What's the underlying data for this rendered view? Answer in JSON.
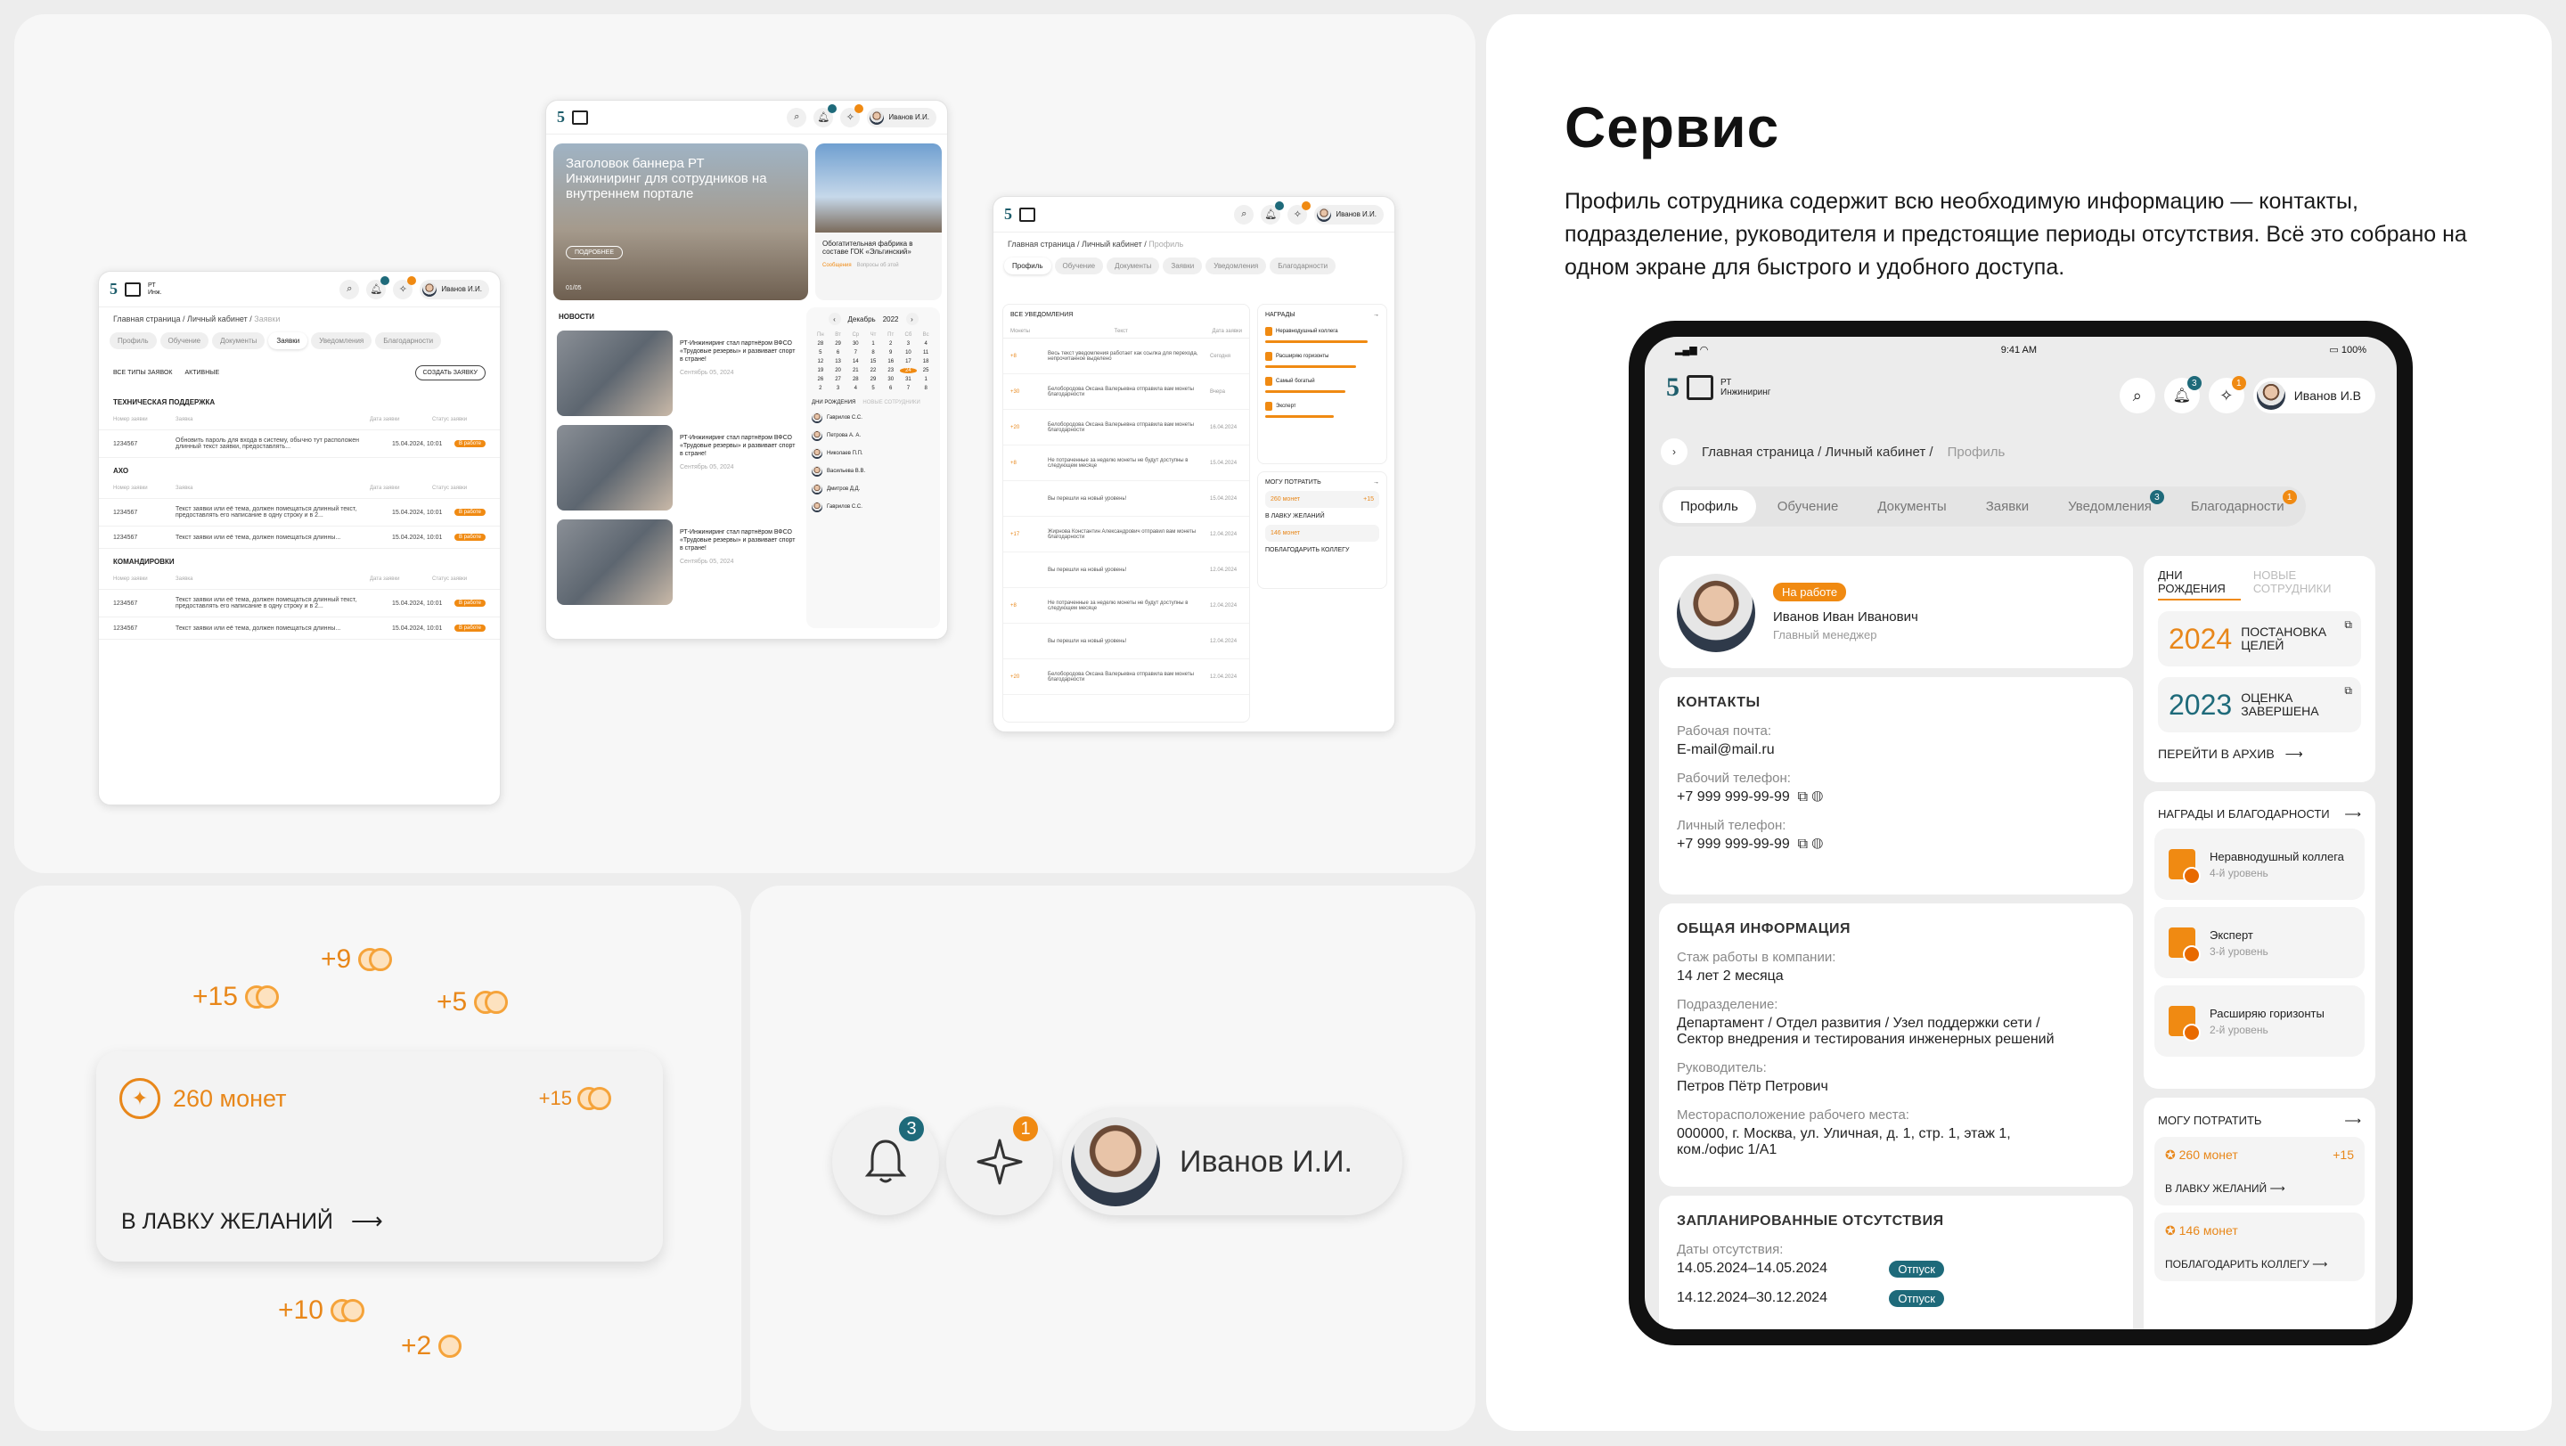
{
  "mock_requests": {
    "user": "Иванов И.И.",
    "crumb_path": "Главная страница / Личный кабинет /",
    "crumb_current": "Заявки",
    "tabs": [
      "Профиль",
      "Обучение",
      "Документы",
      "Заявки",
      "Уведомления",
      "Благодарности"
    ],
    "filter1": "ВСЕ ТИПЫ ЗАЯВОК",
    "filter2": "АКТИВНЫЕ",
    "create_label": "СОЗДАТЬ ЗАЯВКУ",
    "sections": [
      {
        "title": "ТЕХНИЧЕСКАЯ ПОДДЕРЖКА",
        "cols": [
          "Номер заявки",
          "Заявка",
          "Дата заявки",
          "Статус заявки"
        ],
        "rows": [
          {
            "num": "1234567",
            "text": "Обновить пароль для входа в систему, обычно тут расположен длинный текст заявки, предоставлять...",
            "date": "15.04.2024, 10:01",
            "status": "В работе"
          }
        ]
      },
      {
        "title": "АХО",
        "cols": [
          "Номер заявки",
          "Заявка",
          "Дата заявки",
          "Статус заявки"
        ],
        "rows": [
          {
            "num": "1234567",
            "text": "Текст заявки или её тема, должен помещаться длинный текст, предоставлять его написание в одну строку и в 2...",
            "date": "15.04.2024, 10:01",
            "status": "В работе"
          },
          {
            "num": "1234567",
            "text": "Текст заявки или её тема, должен помещаться длинны...",
            "date": "15.04.2024, 10:01",
            "status": "В работе"
          }
        ]
      },
      {
        "title": "КОМАНДИРОВКИ",
        "cols": [
          "Номер заявки",
          "Заявка",
          "Дата заявки",
          "Статус заявки"
        ],
        "rows": [
          {
            "num": "1234567",
            "text": "Текст заявки или её тема, должен помещаться длинный текст, предоставлять его написание в одну строку и в 2...",
            "date": "15.04.2024, 10:01",
            "status": "В работе"
          },
          {
            "num": "1234567",
            "text": "Текст заявки или её тема, должен помещаться длинны...",
            "date": "15.04.2024, 10:01",
            "status": "В работе"
          }
        ]
      }
    ]
  },
  "mock_portal": {
    "user": "Иванов И.И.",
    "banner_title": "Заголовок баннера РТ Инжиниринг для сотрудников на внутреннем портале",
    "banner_btn": "ПОДРОБНЕЕ",
    "banner_counter": "01/05",
    "side_caption": "Обогатительная фабрика в составе ГОК «Эльгинский»",
    "side_tabs": [
      "Сообщения",
      "Вопросы об этой"
    ],
    "news_title": "НОВОСТИ",
    "news": [
      {
        "text": "РТ-Инжиниринг стал партнёром ВФСО «Трудовые резервы» и развивает спорт в стране!",
        "date": "Сентябрь 05, 2024"
      },
      {
        "text": "РТ-Инжиниринг стал партнёром ВФСО «Трудовые резервы» и развивает спорт в стране!",
        "date": "Сентябрь 05, 2024"
      },
      {
        "text": "РТ-Инжиниринг стал партнёром ВФСО «Трудовые резервы» и развивает спорт в стране!",
        "date": "Сентябрь 05, 2024"
      }
    ],
    "cal_month": "Декабрь",
    "cal_year": "2022",
    "cal_days": [
      "Пн",
      "Вт",
      "Ср",
      "Чт",
      "Пт",
      "Сб",
      "Вс"
    ],
    "cal_nums": [
      "28",
      "29",
      "30",
      "1",
      "2",
      "3",
      "4",
      "5",
      "6",
      "7",
      "8",
      "9",
      "10",
      "11",
      "12",
      "13",
      "14",
      "15",
      "16",
      "17",
      "18",
      "19",
      "20",
      "21",
      "22",
      "23",
      "24",
      "25",
      "26",
      "27",
      "28",
      "29",
      "30",
      "31",
      "1",
      "2",
      "3",
      "4",
      "5",
      "6",
      "7",
      "8"
    ],
    "cal_selected": "24",
    "bday_tabs": [
      "ДНИ РОЖДЕНИЯ",
      "НОВЫЕ СОТРУДНИКИ"
    ],
    "bday": [
      "Гаврилов С.С.",
      "Петрова А. А.",
      "Николаев П.П.",
      "Васильева В.В.",
      "Дмитров Д.Д.",
      "Гаврилов С.С."
    ]
  },
  "mock_notifications": {
    "user": "Иванов И.И.",
    "crumb_path": "Главная страница / Личный кабинет /",
    "crumb_current": "Профиль",
    "tabs": [
      "Профиль",
      "Обучение",
      "Документы",
      "Заявки",
      "Уведомления",
      "Благодарности"
    ],
    "filter": "ВСЕ УВЕДОМЛЕНИЯ",
    "cols": [
      "Монеты",
      "Текст",
      "Дата заявки"
    ],
    "rows": [
      {
        "coins": "+8",
        "text": "Весь текст уведомления работает как ссылка для перехода, непрочитанное выделено",
        "date": "Сегодня"
      },
      {
        "coins": "+30",
        "text": "Белобородова Оксана Валерьевна отправила вам монеты благодарности",
        "date": "Вчера"
      },
      {
        "coins": "+20",
        "text": "Белобородова Оксана Валерьевна отправила вам монеты благодарности",
        "date": "16.04.2024"
      },
      {
        "coins": "+8",
        "text": "Не потраченные за неделю монеты не будут доступны в следующем месяце",
        "date": "15.04.2024"
      },
      {
        "coins": "",
        "text": "Вы перешли на новый уровень!",
        "date": "15.04.2024"
      },
      {
        "coins": "+17",
        "text": "Жирнова Константин Александрович отправил вам монеты благодарности",
        "date": "12.04.2024"
      },
      {
        "coins": "",
        "text": "Вы перешли на новый уровень!",
        "date": "12.04.2024"
      },
      {
        "coins": "+8",
        "text": "Не потраченные за неделю монеты не будут доступны в следующем месяце",
        "date": "12.04.2024"
      },
      {
        "coins": "",
        "text": "Вы перешли на новый уровень!",
        "date": "12.04.2024"
      },
      {
        "coins": "+20",
        "text": "Белобородова Оксана Валерьевна отправила вам монеты благодарности",
        "date": "12.04.2024"
      }
    ],
    "side_awards_title": "НАГРАДЫ",
    "side_awards": [
      "Неравнодушный коллега",
      "Расширяю горизонты",
      "Самый богатый",
      "Эксперт"
    ],
    "side_spend_title": "МОГУ ПОТРАТИТЬ",
    "side_coins": "260 монет",
    "side_plus": "+15",
    "side_shop": "В ЛАВКУ ЖЕЛАНИЙ",
    "side_coins2": "146 монет",
    "side_thank": "ПОБЛАГОДАРИТЬ КОЛЛЕГУ"
  },
  "coins_panel": {
    "floats": [
      "+9",
      "+15",
      "+5",
      "+10",
      "+2"
    ],
    "coins_label": "260 монет",
    "plus": "+15",
    "shop_label": "В ЛАВКУ ЖЕЛАНИЙ"
  },
  "header_panel": {
    "bell_count": "3",
    "spark_count": "1",
    "user": "Иванов И.И."
  },
  "service": {
    "title": "Сервис",
    "description": "Профиль сотрудника содержит всю необходимую информацию — контакты, подразделение, руководителя и предстоящие периоды отсутствия. Всё это собрано на одном экране для быстрого и удобного доступа."
  },
  "tablet": {
    "time": "9:41 AM",
    "battery": "100%",
    "logo_text": "РТ Инжиниринг",
    "bell_count": "3",
    "spark_count": "1",
    "user": "Иванов И.В",
    "crumb_path": "Главная страница / Личный кабинет /",
    "crumb_current": "Профиль",
    "tabs": [
      "Профиль",
      "Обучение",
      "Документы",
      "Заявки",
      "Уведомления",
      "Благодарности"
    ],
    "notif_badge": "3",
    "thanks_badge": "1",
    "profile": {
      "status": "На работе",
      "name": "Иванов Иван Иванович",
      "position": "Главный менеджер"
    },
    "contacts": {
      "title": "КОНТАКТЫ",
      "email_label": "Рабочая почта:",
      "email": "E-mail@mail.ru",
      "work_phone_label": "Рабочий телефон:",
      "work_phone": "+7 999 999-99-99",
      "personal_phone_label": "Личный телефон:",
      "personal_phone": "+7 999 999-99-99"
    },
    "general": {
      "title": "ОБЩАЯ ИНФОРМАЦИЯ",
      "tenure_label": "Стаж работы в компании:",
      "tenure": "14 лет 2 месяца",
      "dept_label": "Подразделение:",
      "dept": "Департамент / Отдел развития / Узел поддержки сети / Сектор внедрения и тестирования инженерных решений",
      "manager_label": "Руководитель:",
      "manager": "Петров Пётр Петрович",
      "location_label": "Месторасположение рабочего места:",
      "location": "000000, г. Москва, ул. Уличная, д. 1, стр. 1, этаж 1, ком./офис 1/А1"
    },
    "absences": {
      "title": "ЗАПЛАНИРОВАННЫЕ ОТСУТСТВИЯ",
      "dates_label": "Даты отсутствия:",
      "period1": "14.05.2024–14.05.2024",
      "type1": "Отпуск",
      "period2": "14.12.2024–30.12.2024",
      "type2": "Отпуск"
    },
    "right_tabs": [
      "ДНИ РОЖДЕНИЯ",
      "НОВЫЕ СОТРУДНИКИ"
    ],
    "goals": [
      {
        "year": "2024",
        "text": "ПОСТАНОВКА ЦЕЛЕЙ"
      },
      {
        "year": "2023",
        "text": "ОЦЕНКА ЗАВЕРШЕНА"
      }
    ],
    "archive_label": "ПЕРЕЙТИ В АРХИВ",
    "awards_title": "НАГРАДЫ И БЛАГОДАРНОСТИ",
    "awards": [
      {
        "name": "Неравнодушный коллега",
        "level": "4-й уровень"
      },
      {
        "name": "Эксперт",
        "level": "3-й уровень"
      },
      {
        "name": "Расширяю горизонты",
        "level": "2-й уровень"
      }
    ],
    "spend_title": "МОГУ ПОТРАТИТЬ",
    "coins": "260 монет",
    "plus": "+15",
    "shop_label": "В ЛАВКУ ЖЕЛАНИЙ",
    "coins2": "146 монет",
    "thank_label": "ПОБЛАГОДАРИТЬ КОЛЛЕГУ"
  }
}
